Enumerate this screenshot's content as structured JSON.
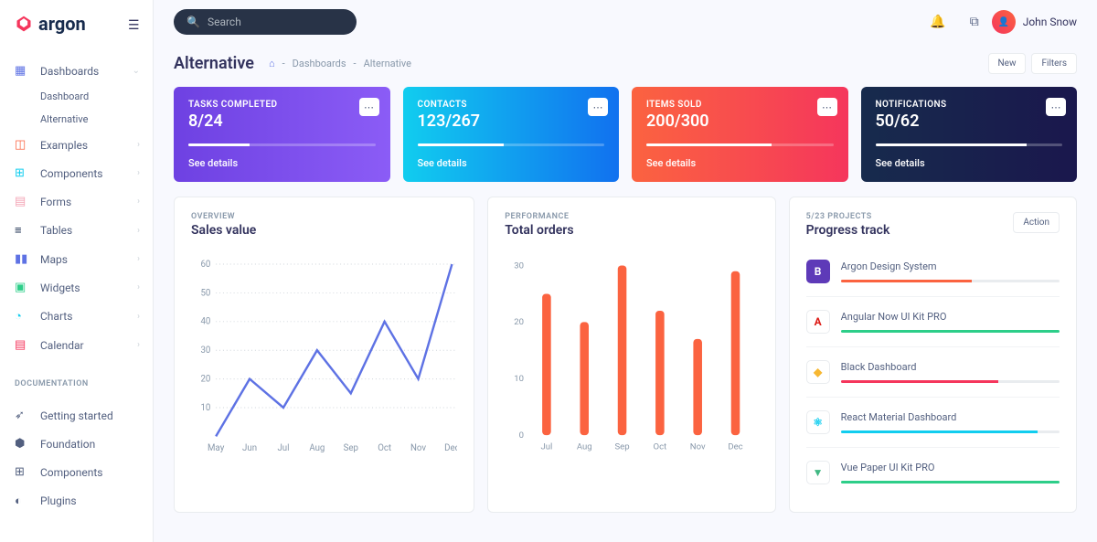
{
  "brand": "argon",
  "search": {
    "placeholder": "Search"
  },
  "user": {
    "name": "John Snow"
  },
  "sidebar": {
    "items": [
      {
        "icon": "▦",
        "label": "Dashboards",
        "expanded": true,
        "children": [
          "Dashboard",
          "Alternative"
        ]
      },
      {
        "icon": "◫",
        "label": "Examples"
      },
      {
        "icon": "⊞",
        "label": "Components"
      },
      {
        "icon": "▤",
        "label": "Forms"
      },
      {
        "icon": "≡",
        "label": "Tables"
      },
      {
        "icon": "▮▮",
        "label": "Maps"
      },
      {
        "icon": "▣",
        "label": "Widgets"
      },
      {
        "icon": "◔",
        "label": "Charts"
      },
      {
        "icon": "▤",
        "label": "Calendar"
      }
    ],
    "doc_heading": "DOCUMENTATION",
    "docs": [
      {
        "icon": "➶",
        "label": "Getting started"
      },
      {
        "icon": "⬢",
        "label": "Foundation"
      },
      {
        "icon": "⊞",
        "label": "Components"
      },
      {
        "icon": "◐",
        "label": "Plugins"
      }
    ]
  },
  "header": {
    "title": "Alternative",
    "breadcrumb": [
      "Dashboards",
      "Alternative"
    ],
    "actions": [
      "New",
      "Filters"
    ]
  },
  "cards": [
    {
      "label": "TASKS COMPLETED",
      "value": "8/24",
      "progress": 33,
      "link": "See details"
    },
    {
      "label": "CONTACTS",
      "value": "123/267",
      "progress": 46,
      "link": "See details"
    },
    {
      "label": "ITEMS SOLD",
      "value": "200/300",
      "progress": 67,
      "link": "See details"
    },
    {
      "label": "NOTIFICATIONS",
      "value": "50/62",
      "progress": 81,
      "link": "See details"
    }
  ],
  "sales": {
    "overline": "OVERVIEW",
    "title": "Sales value"
  },
  "orders": {
    "overline": "PERFORMANCE",
    "title": "Total orders"
  },
  "progress_panel": {
    "overline": "5/23 PROJECTS",
    "title": "Progress track",
    "action": "Action"
  },
  "tracks": [
    {
      "name": "Argon Design System",
      "color": "#fb6340",
      "pct": 60,
      "icon_bg": "#5e3ab8",
      "icon": "B"
    },
    {
      "name": "Angular Now UI Kit PRO",
      "color": "#2dce89",
      "pct": 100,
      "icon_bg": "#ffffff",
      "icon": "A",
      "icon_color": "#dd1b16",
      "border": true
    },
    {
      "name": "Black Dashboard",
      "color": "#f5365c",
      "pct": 72,
      "icon_bg": "#ffffff",
      "icon": "◆",
      "icon_color": "#f7b731",
      "border": true
    },
    {
      "name": "React Material Dashboard",
      "color": "#11cdef",
      "pct": 90,
      "icon_bg": "#ffffff",
      "icon": "⚛",
      "icon_color": "#11cdef",
      "border": true
    },
    {
      "name": "Vue Paper UI Kit PRO",
      "color": "#2dce89",
      "pct": 100,
      "icon_bg": "#ffffff",
      "icon": "▼",
      "icon_color": "#41b883",
      "border": true
    }
  ],
  "chart_data": [
    {
      "type": "line",
      "title": "Sales value",
      "xlabel": "",
      "ylabel": "",
      "ylim": [
        0,
        60
      ],
      "categories": [
        "May",
        "Jun",
        "Jul",
        "Aug",
        "Sep",
        "Oct",
        "Nov",
        "Dec"
      ],
      "values": [
        0,
        20,
        10,
        30,
        15,
        40,
        20,
        60
      ]
    },
    {
      "type": "bar",
      "title": "Total orders",
      "xlabel": "",
      "ylabel": "",
      "ylim": [
        0,
        30
      ],
      "categories": [
        "Jul",
        "Aug",
        "Sep",
        "Oct",
        "Nov",
        "Dec"
      ],
      "values": [
        25,
        20,
        30,
        22,
        17,
        29
      ]
    }
  ]
}
